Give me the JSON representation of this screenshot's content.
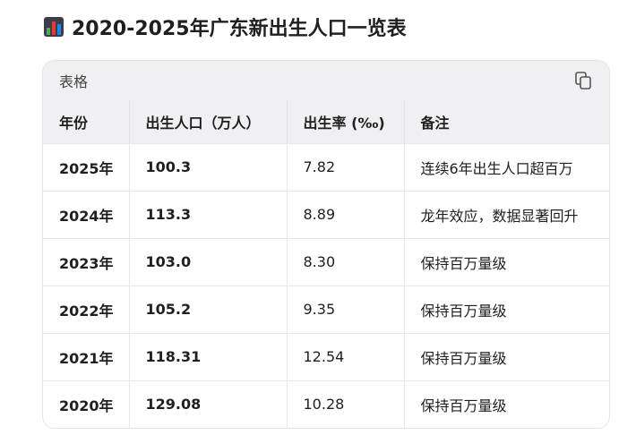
{
  "heading": {
    "icon": "bar-chart-emoji-icon",
    "title": "2020-2025年广东新出生人口一览表"
  },
  "card": {
    "title": "表格",
    "copy_icon": "copy-icon"
  },
  "table": {
    "headers": [
      "年份",
      "出生人口（万人）",
      "出生率 (‰)",
      "备注"
    ],
    "rows": [
      [
        "2025年",
        "100.3",
        "7.82",
        "连续6年出生人口超百万"
      ],
      [
        "2024年",
        "113.3",
        "8.89",
        "龙年效应，数据显著回升"
      ],
      [
        "2023年",
        "103.0",
        "8.30",
        "保持百万量级"
      ],
      [
        "2022年",
        "105.2",
        "9.35",
        "保持百万量级"
      ],
      [
        "2021年",
        "118.31",
        "12.54",
        "保持百万量级"
      ],
      [
        "2020年",
        "129.08",
        "10.28",
        "保持百万量级"
      ]
    ]
  }
}
